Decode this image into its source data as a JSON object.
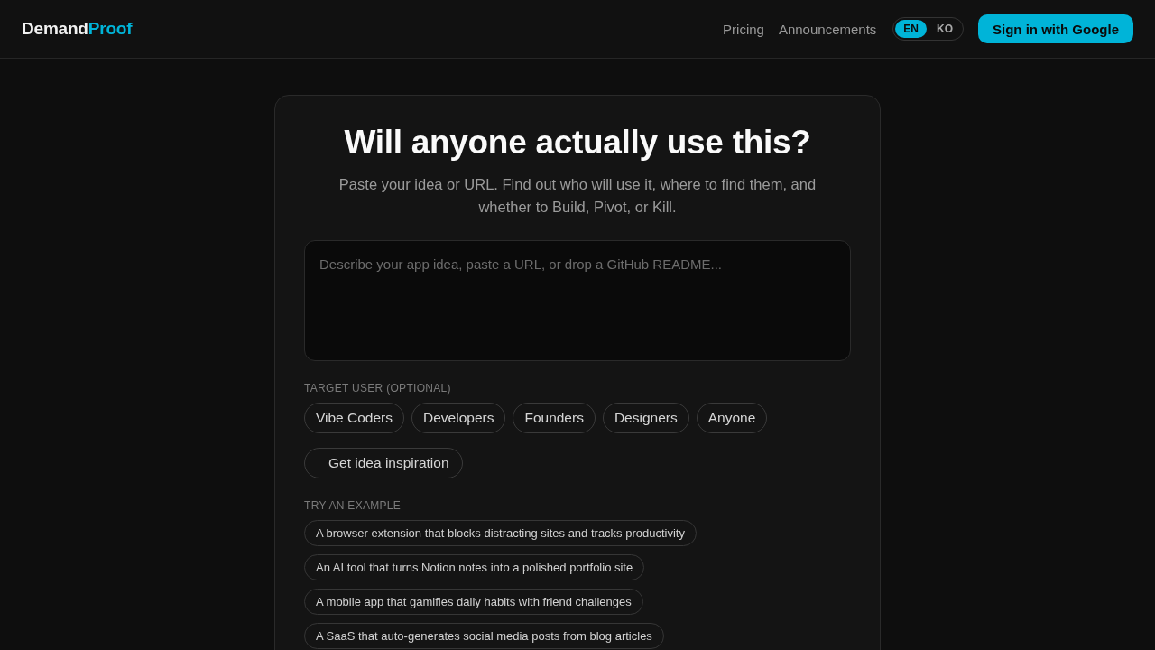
{
  "header": {
    "logo": [
      {
        "kind": "plain",
        "text": "Demand"
      },
      {
        "kind": "accent",
        "text": "Proof"
      }
    ],
    "nav": [
      "Pricing",
      "Announcements"
    ],
    "languages": [
      {
        "label": "EN",
        "selected": true
      },
      {
        "label": "KO",
        "selected": false
      }
    ],
    "sign_in": "Sign in with Google"
  },
  "hero": {
    "title": "Will anyone actually use this?",
    "subtitle": "Paste your idea or URL. Find out who will use it, where to find them, and whether to Build, Pivot, or Kill.",
    "input": {
      "placeholder": "Describe your app idea, paste a URL, or drop a GitHub README..."
    }
  },
  "target_user": {
    "label": "TARGET USER (OPTIONAL)",
    "options": [
      {
        "label": "Vibe Coders",
        "selected": false
      },
      {
        "label": "Developers",
        "selected": false
      },
      {
        "label": "Founders",
        "selected": false
      },
      {
        "label": "Designers",
        "selected": false
      },
      {
        "label": "Anyone",
        "selected": false
      }
    ]
  },
  "inspiration_button": "Get idea inspiration",
  "examples": {
    "label": "TRY AN EXAMPLE",
    "items": [
      "A browser extension that blocks distracting sites and tracks productivity",
      "An AI tool that turns Notion notes into a polished portfolio site",
      "A mobile app that gamifies daily habits with friend challenges",
      "A SaaS that auto-generates social media posts from blog articles"
    ]
  }
}
